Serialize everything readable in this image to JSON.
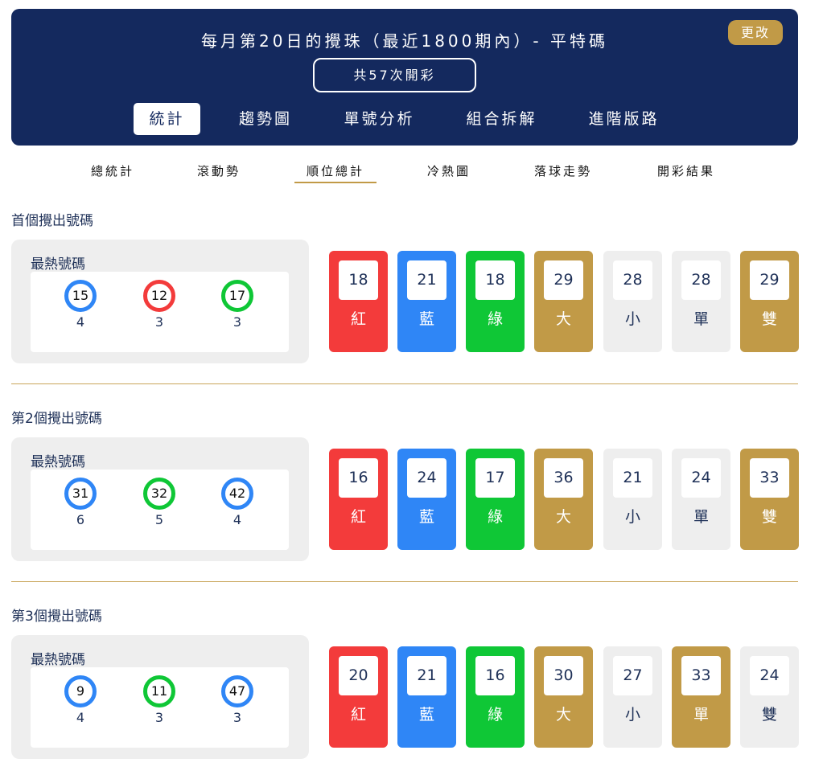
{
  "header": {
    "title": "每月第20日的攪珠（最近1800期內）- 平特碼",
    "change_button": "更改",
    "draw_count": "共57次開彩",
    "tabs": [
      "統計",
      "趨勢圖",
      "單號分析",
      "組合拆解",
      "進階版路"
    ],
    "active_tab": "統計"
  },
  "sub_tabs": [
    "總統計",
    "滾動勢",
    "順位總計",
    "冷熱圖",
    "落球走勢",
    "開彩結果"
  ],
  "active_sub_tab": "順位總計",
  "colors": {
    "header_bg": "#14295e",
    "gold": "#c19a47",
    "red": "#f33b3b",
    "blue": "#2f86f6",
    "green": "#0fc736",
    "light": "#eeeeee"
  },
  "sections": [
    {
      "title": "首個攪出號碼",
      "hot_label": "最熱號碼",
      "hot_numbers": [
        {
          "number": "15",
          "count": "4",
          "color": "blue"
        },
        {
          "number": "12",
          "count": "3",
          "color": "red"
        },
        {
          "number": "17",
          "count": "3",
          "color": "green"
        }
      ],
      "stats": [
        {
          "value": "18",
          "label": "紅",
          "color": "red"
        },
        {
          "value": "21",
          "label": "藍",
          "color": "blue"
        },
        {
          "value": "18",
          "label": "綠",
          "color": "green"
        },
        {
          "value": "29",
          "label": "大",
          "color": "gold"
        },
        {
          "value": "28",
          "label": "小",
          "color": "light"
        },
        {
          "value": "28",
          "label": "單",
          "color": "light"
        },
        {
          "value": "29",
          "label": "雙",
          "color": "gold"
        }
      ]
    },
    {
      "title": "第2個攪出號碼",
      "hot_label": "最熱號碼",
      "hot_numbers": [
        {
          "number": "31",
          "count": "6",
          "color": "blue"
        },
        {
          "number": "32",
          "count": "5",
          "color": "green"
        },
        {
          "number": "42",
          "count": "4",
          "color": "blue"
        }
      ],
      "stats": [
        {
          "value": "16",
          "label": "紅",
          "color": "red"
        },
        {
          "value": "24",
          "label": "藍",
          "color": "blue"
        },
        {
          "value": "17",
          "label": "綠",
          "color": "green"
        },
        {
          "value": "36",
          "label": "大",
          "color": "gold"
        },
        {
          "value": "21",
          "label": "小",
          "color": "light"
        },
        {
          "value": "24",
          "label": "單",
          "color": "light"
        },
        {
          "value": "33",
          "label": "雙",
          "color": "gold"
        }
      ]
    },
    {
      "title": "第3個攪出號碼",
      "hot_label": "最熱號碼",
      "hot_numbers": [
        {
          "number": "9",
          "count": "4",
          "color": "blue"
        },
        {
          "number": "11",
          "count": "3",
          "color": "green"
        },
        {
          "number": "47",
          "count": "3",
          "color": "blue"
        }
      ],
      "stats": [
        {
          "value": "20",
          "label": "紅",
          "color": "red"
        },
        {
          "value": "21",
          "label": "藍",
          "color": "blue"
        },
        {
          "value": "16",
          "label": "綠",
          "color": "green"
        },
        {
          "value": "30",
          "label": "大",
          "color": "gold"
        },
        {
          "value": "27",
          "label": "小",
          "color": "light"
        },
        {
          "value": "33",
          "label": "單",
          "color": "gold"
        },
        {
          "value": "24",
          "label": "雙",
          "color": "light"
        }
      ]
    }
  ]
}
